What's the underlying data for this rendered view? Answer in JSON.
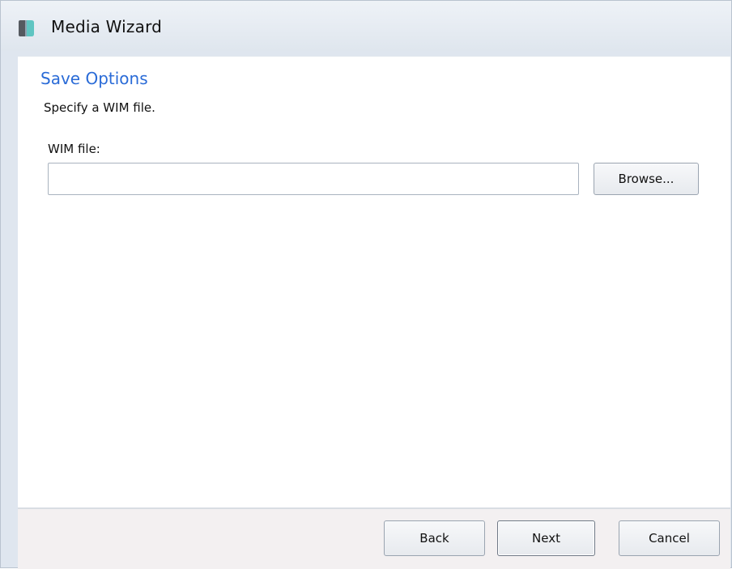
{
  "window": {
    "title": "Media Wizard",
    "icon": "media-wizard-app-icon"
  },
  "page": {
    "section_title": "Save Options",
    "subtitle": "Specify a WIM file."
  },
  "wim_field": {
    "label": "WIM file:",
    "value": "",
    "browse_label": "Browse..."
  },
  "footer": {
    "back_label": "Back",
    "next_label": "Next",
    "cancel_label": "Cancel"
  },
  "colors": {
    "accent": "#2a6bd7",
    "titlebar": "#e3e9f0",
    "footer": "#f3f0f1"
  }
}
